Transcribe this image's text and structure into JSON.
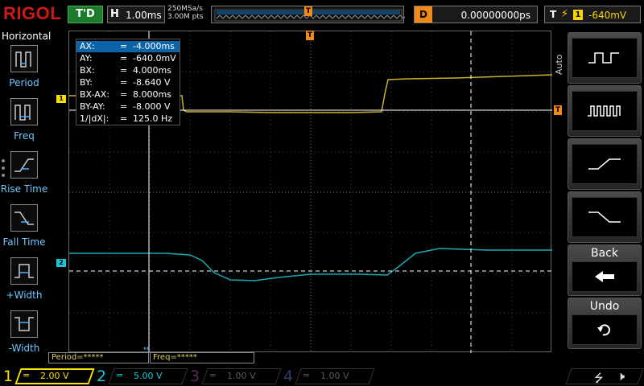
{
  "header": {
    "brand": "RIGOL",
    "run_status": "T'D",
    "timebase_label": "H",
    "timebase_value": "1.00ms",
    "sample_rate": "250MSa/s",
    "memory_depth": "3.00M pts",
    "trigger_pos_marker": "T",
    "delay_label": "D",
    "delay_value": "0.00000000ps",
    "trigger_label": "T",
    "trigger_edge": "rising-edge-icon",
    "trigger_source": "1",
    "trigger_level": "-640mV"
  },
  "left_menu": {
    "title": "Horizontal",
    "items": [
      {
        "label": "Period",
        "icon": "period-icon"
      },
      {
        "label": "Freq",
        "icon": "freq-icon"
      },
      {
        "label": "Rise Time",
        "icon": "rise-time-icon"
      },
      {
        "label": "Fall Time",
        "icon": "fall-time-icon"
      },
      {
        "label": "+Width",
        "icon": "positive-width-icon"
      },
      {
        "label": "-Width",
        "icon": "negative-width-icon"
      }
    ]
  },
  "cursor_table": {
    "rows": [
      {
        "key": "AX:",
        "eq": "=",
        "value": "-4.000ms",
        "selected": true
      },
      {
        "key": "AY:",
        "eq": "=",
        "value": "-640.0mV"
      },
      {
        "key": "BX:",
        "eq": "=",
        "value": "4.000ms"
      },
      {
        "key": "BY:",
        "eq": "=",
        "value": "-8.640 V"
      },
      {
        "key": "BX-AX:",
        "eq": "=",
        "value": "8.000ms"
      },
      {
        "key": "BY-AY:",
        "eq": "=",
        "value": "-8.000 V"
      },
      {
        "key": "1/|dX|:",
        "eq": "=",
        "value": "125.0 Hz"
      }
    ]
  },
  "markers": {
    "ch1": "1",
    "ch2": "2",
    "trigger_top": "T",
    "trigger_level": "T"
  },
  "status_boxes": {
    "period": "Period=*****",
    "freq": "Freq=*****"
  },
  "right_menu": {
    "side_label": "Auto",
    "buttons": [
      {
        "name": "auto-period",
        "icon": "square-wave-icon"
      },
      {
        "name": "auto-freq",
        "icon": "pulse-train-icon"
      },
      {
        "name": "auto-rise",
        "icon": "rising-edge-icon"
      },
      {
        "name": "auto-fall",
        "icon": "falling-edge-icon"
      },
      {
        "name": "back",
        "label": "Back",
        "icon": "left-arrow-icon"
      },
      {
        "name": "undo",
        "label": "Undo",
        "icon": "undo-icon"
      }
    ]
  },
  "channels": [
    {
      "num": "1",
      "coupling": "=",
      "scale": "2.00 V",
      "color": "#f5e000",
      "active": true
    },
    {
      "num": "2",
      "coupling": "=",
      "scale": "5.00 V",
      "color": "#18c8d8",
      "active": true
    },
    {
      "num": "3",
      "coupling": "=",
      "scale": "1.00 V",
      "color": "#d030c8",
      "active": false
    },
    {
      "num": "4",
      "coupling": "=",
      "scale": "1.00 V",
      "color": "#3070e0",
      "active": false
    }
  ],
  "footer": {
    "usb_icon": "usb-icon",
    "speaker_icon": "speaker-muted-icon"
  },
  "colors": {
    "ch1": "#c8b428",
    "ch2": "#1aa8b4",
    "trigger": "#f28a1a",
    "menu_label": "#6fc6ff",
    "brand": "#d01818"
  }
}
